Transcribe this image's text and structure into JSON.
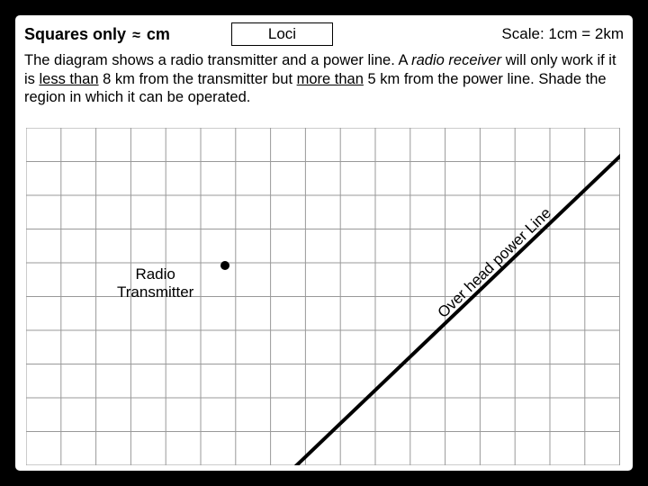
{
  "header": {
    "squares_prefix": "Squares only",
    "approx": "≈",
    "squares_suffix": "cm",
    "title": "Loci",
    "scale": "Scale: 1cm = 2km"
  },
  "problem": {
    "p1a": "The diagram shows a radio transmitter and a power line. A ",
    "p1b": "radio receiver",
    "p1c": " will only work if it is ",
    "p1d": "less than",
    "p1e": " 8 km from the transmitter but ",
    "p1f": "more than",
    "p1g": " 5 km from the power line. Shade the region in which it can be operated."
  },
  "labels": {
    "transmitter_l1": "Radio",
    "transmitter_l2": "Transmitter",
    "powerline": "Over head power Line"
  },
  "chart_data": {
    "type": "diagram",
    "title": "Loci",
    "scale_cm_to_km": 2,
    "grid_cell_cm": 1,
    "grid_cols": 17,
    "grid_rows": 10,
    "transmitter": {
      "x_cm": 5.7,
      "y_cm": 4.1
    },
    "power_line": {
      "p1": [
        7.4,
        10
      ],
      "p2": [
        17,
        0.8
      ],
      "note": "straight line across grid"
    },
    "constraints": {
      "max_dist_from_transmitter_km": 8,
      "min_dist_from_powerline_km": 5
    }
  }
}
